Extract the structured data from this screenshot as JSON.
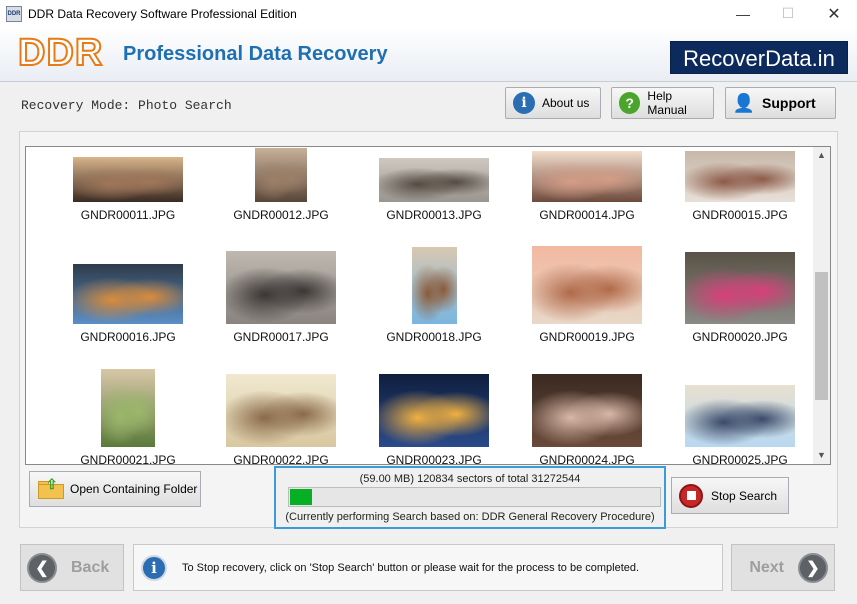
{
  "window": {
    "title": "DDR Data Recovery Software Professional Edition",
    "app_icon_text": "DDR"
  },
  "header": {
    "logo": "DDR",
    "title": "Professional Data Recovery",
    "website": "RecoverData.in"
  },
  "toolbar": {
    "mode_label": "Recovery Mode: Photo Search",
    "about_label": "About us",
    "help_label": "Help Manual",
    "support_label": "Support"
  },
  "gallery": {
    "files": [
      {
        "name": "GNDR00011.JPG",
        "colors": [
          "#3a2a22",
          "#a0765a",
          "#d8b48a"
        ]
      },
      {
        "name": "GNDR00012.JPG",
        "colors": [
          "#5a4638",
          "#9c8068",
          "#c8b19a"
        ]
      },
      {
        "name": "GNDR00013.JPG",
        "colors": [
          "#9a9590",
          "#554b42",
          "#cfc8c0"
        ]
      },
      {
        "name": "GNDR00014.JPG",
        "colors": [
          "#6e4a3c",
          "#d49c86",
          "#f2dccc"
        ]
      },
      {
        "name": "GNDR00015.JPG",
        "colors": [
          "#e8e0d8",
          "#8c5a48",
          "#c7b7a8"
        ]
      },
      {
        "name": "GNDR00016.JPG",
        "colors": [
          "#5b8fc6",
          "#d98c3c",
          "#2e3b4a"
        ]
      },
      {
        "name": "GNDR00017.JPG",
        "colors": [
          "#8a8480",
          "#3a3634",
          "#bfb8b0"
        ]
      },
      {
        "name": "GNDR00018.JPG",
        "colors": [
          "#7ab6e0",
          "#8a5a3a",
          "#d8c8b0"
        ]
      },
      {
        "name": "GNDR00019.JPG",
        "colors": [
          "#e8d8c8",
          "#b06a4a",
          "#f2b8a0"
        ]
      },
      {
        "name": "GNDR00020.JPG",
        "colors": [
          "#8a8a86",
          "#d8407a",
          "#5a5246"
        ]
      },
      {
        "name": "GNDR00021.JPG",
        "colors": [
          "#5a7a3a",
          "#9ab86a",
          "#d8c8a8"
        ]
      },
      {
        "name": "GNDR00022.JPG",
        "colors": [
          "#d8c8a0",
          "#8a6a4a",
          "#f0e8d0"
        ]
      },
      {
        "name": "GNDR00023.JPG",
        "colors": [
          "#2a4a8a",
          "#f0b040",
          "#0e1e3e"
        ]
      },
      {
        "name": "GNDR00024.JPG",
        "colors": [
          "#6a4a3a",
          "#d8b8a8",
          "#3a2a22"
        ]
      },
      {
        "name": "GNDR00025.JPG",
        "colors": [
          "#b8d8f0",
          "#3a4a6a",
          "#e8e0d0"
        ]
      }
    ]
  },
  "actions": {
    "open_folder_label": "Open Containing Folder",
    "stop_label": "Stop Search"
  },
  "progress": {
    "stats": "(59.00 MB) 120834  sectors  of  total 31272544",
    "fraction": 0.06,
    "status": "(Currently performing Search based on:  DDR General Recovery Procedure)"
  },
  "footer": {
    "back_label": "Back",
    "next_label": "Next",
    "info_text": "To Stop recovery, click on 'Stop Search' button or please wait for the process to be completed."
  }
}
